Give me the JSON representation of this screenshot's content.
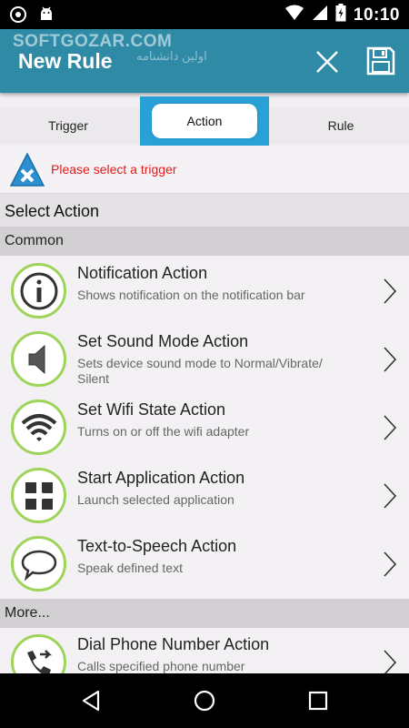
{
  "status_bar": {
    "time": "10:10",
    "icons": [
      "sync-icon",
      "android-icon",
      "wifi-icon",
      "signal-icon",
      "battery-icon"
    ]
  },
  "app_bar": {
    "title": "New Rule",
    "watermark": "SOFTGOZAR.COM",
    "watermark_sub": "اولین دانشنامه",
    "close_icon": "close-icon",
    "save_icon": "save-icon",
    "bg_color": "#2f8aa6"
  },
  "tabs": [
    {
      "label": "Trigger",
      "selected": false
    },
    {
      "label": "Action",
      "selected": true
    },
    {
      "label": "Rule",
      "selected": false
    }
  ],
  "warning": {
    "text": "Please select a trigger",
    "color": "#e21b1b",
    "icon": "error-x-icon"
  },
  "select_header": "Select Action",
  "sections": {
    "common": "Common",
    "more": "More..."
  },
  "actions": [
    {
      "title": "Notification Action",
      "desc": "Shows notification on the notification bar",
      "icon": "info-icon"
    },
    {
      "title": "Set Sound Mode Action",
      "desc": "Sets device sound mode to Normal/Vibrate/ Silent",
      "icon": "speaker-icon"
    },
    {
      "title": "Set Wifi State Action",
      "desc": "Turns on or off the wifi adapter",
      "icon": "wifi-icon"
    },
    {
      "title": "Start Application Action",
      "desc": "Launch selected application",
      "icon": "app-launch-icon"
    },
    {
      "title": "Text-to-Speech Action",
      "desc": "Speak defined text",
      "icon": "speech-bubble-icon"
    },
    {
      "title": "Dial Phone Number Action",
      "desc": "Calls specified phone number",
      "icon": "phone-icon"
    }
  ],
  "nav_bar": {
    "icons": [
      "back-icon",
      "home-icon",
      "recents-icon"
    ]
  }
}
